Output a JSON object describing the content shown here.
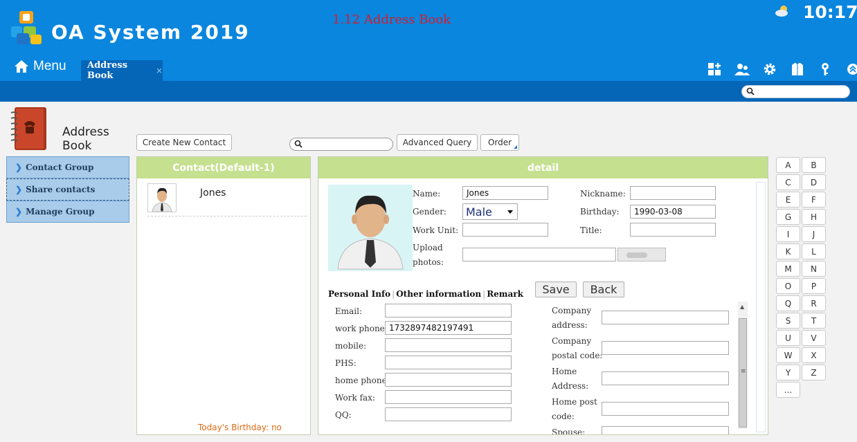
{
  "header": {
    "app_title": "OA System 2019",
    "page_subtitle": "1.12 Address Book",
    "clock": "10:17",
    "menu_label": "Menu",
    "active_tab": "Address Book",
    "tab_close": "×",
    "brand_color": "#0a86df"
  },
  "module": {
    "title_line1": "Address",
    "title_line2": "Book"
  },
  "sidebar": {
    "items": [
      {
        "label": "Contact Group"
      },
      {
        "label": "Share contacts"
      },
      {
        "label": "Manage Group"
      }
    ]
  },
  "toolbar": {
    "create_label": "Create New Contact",
    "search_placeholder": "",
    "advanced_label": "Advanced Query",
    "order_label": "Order"
  },
  "contacts_panel": {
    "title": "Contact(Default-1)",
    "contacts": [
      {
        "name": "Jones"
      }
    ],
    "birthday_text": "Today's Birthday: no"
  },
  "detail": {
    "title": "detail",
    "name_label": "Name:",
    "name_value": "Jones",
    "nickname_label": "Nickname:",
    "nickname_value": "",
    "gender_label": "Gender:",
    "gender_value": "Male",
    "birthday_label": "Birthday:",
    "birthday_value": "1990-03-08",
    "workunit_label": "Work Unit:",
    "workunit_value": "",
    "title_label": "Title:",
    "title_value": "",
    "upload_label_1": "Upload",
    "upload_label_2": "photos:",
    "tabs": [
      "Personal Info",
      "Other information",
      "Remark"
    ],
    "save_label": "Save",
    "back_label": "Back",
    "personal": [
      {
        "label": "Email:",
        "value": ""
      },
      {
        "label": "work phone:",
        "value": "1732897482197491"
      },
      {
        "label": "mobile:",
        "value": ""
      },
      {
        "label": "PHS:",
        "value": ""
      },
      {
        "label": "home phone:",
        "value": ""
      },
      {
        "label": "Work fax:",
        "value": ""
      },
      {
        "label": "QQ:",
        "value": ""
      }
    ],
    "company": [
      {
        "label1": "Company",
        "label2": "address:",
        "value": ""
      },
      {
        "label1": "Company",
        "label2": "postal code:",
        "value": ""
      },
      {
        "label1": "Home",
        "label2": "Address:",
        "value": ""
      },
      {
        "label1": "Home post",
        "label2": "code:",
        "value": ""
      },
      {
        "label1": "Spouse:",
        "label2": "",
        "value": ""
      }
    ]
  },
  "alphabet": [
    "A",
    "B",
    "C",
    "D",
    "E",
    "F",
    "G",
    "H",
    "I",
    "J",
    "K",
    "L",
    "M",
    "N",
    "O",
    "P",
    "Q",
    "R",
    "S",
    "T",
    "U",
    "V",
    "W",
    "X",
    "Y",
    "Z",
    "..."
  ]
}
